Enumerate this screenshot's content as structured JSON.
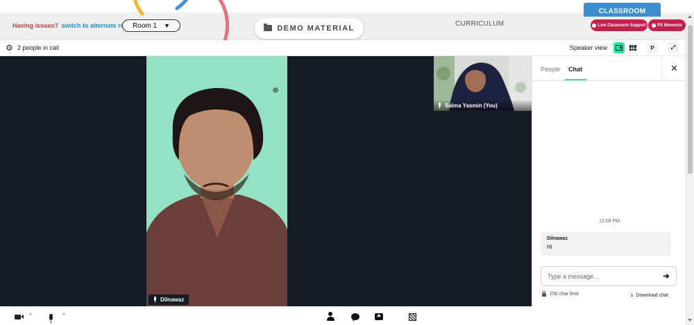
{
  "header": {
    "issues_text": "Having issues?",
    "alternate_room_link": "switch to alternate room",
    "room_select_value": "Room 1",
    "demo_material_label": "DEMO MATERIAL",
    "curriculum_label": "CURRICULUM",
    "classroom_tab_label": "CLASSROOM",
    "support_button_label": "Live Classroom Support",
    "moments_button_label": "PS Moments"
  },
  "toolbar": {
    "people_count": "2 people in call",
    "view_label": "Speaker view",
    "p_button_label": "P"
  },
  "videos": {
    "main_name": "Dilnawaz",
    "thumb_name": "Salma Yasmin (You)"
  },
  "chat": {
    "tab_people": "People",
    "tab_chat": "Chat",
    "close_glyph": "✕",
    "timestamp": "12:09 PM",
    "messages": [
      {
        "sender": "Dilnawaz",
        "text": "Hi"
      }
    ],
    "input_placeholder": "Type a message...",
    "send_glyph": "➔",
    "char_limit": "256 char limit",
    "download_label": "Download chat"
  },
  "icons": {
    "gear": "gear-icon",
    "folder": "folder-icon",
    "speaker_view": "speaker-view-icon",
    "grid_view": "grid-view-icon",
    "fullscreen": "fullscreen-icon",
    "mic": "microphone-icon",
    "camera": "camera-icon",
    "person": "person-icon",
    "chat": "chat-icon",
    "share_screen": "share-screen-icon",
    "whiteboard": "whiteboard-icon",
    "lock": "lock-icon",
    "download": "download-icon",
    "close": "close-icon",
    "send": "send-arrow-icon"
  },
  "colors": {
    "accent_green": "#2ee3a6",
    "brand_red": "#c51f4d",
    "classroom_blue": "#3c8ed0",
    "link_blue": "#1e8fd6",
    "alert_red": "#d33a3a",
    "stage_dark": "#141b23"
  }
}
